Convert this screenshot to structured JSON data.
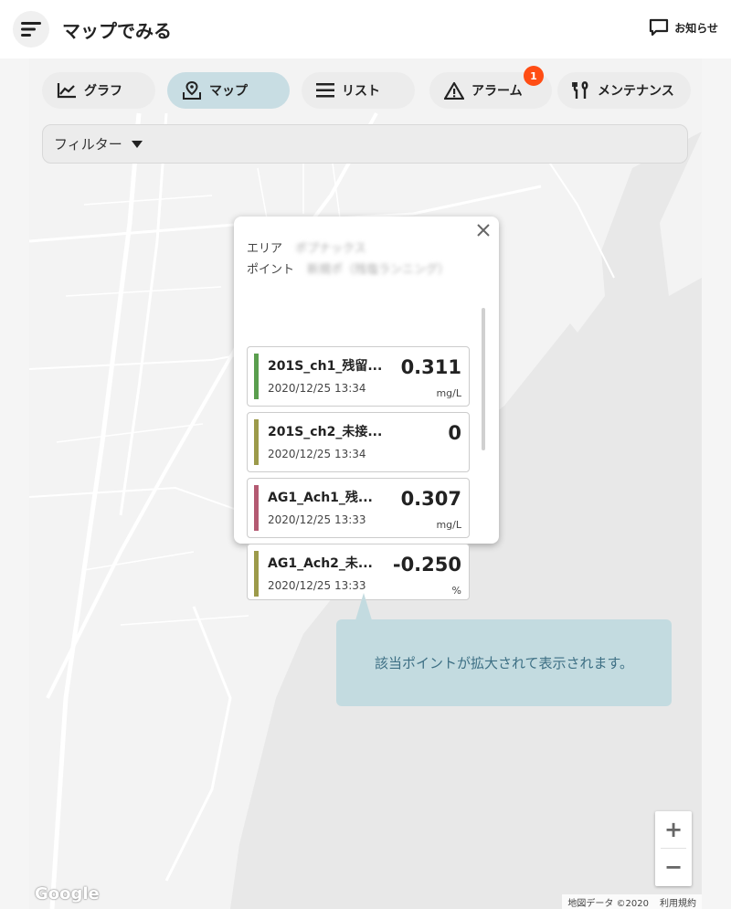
{
  "header": {
    "title": "マップでみる",
    "notice_label": "お知らせ"
  },
  "tabs": [
    {
      "label": "グラフ",
      "icon": "line-chart-icon"
    },
    {
      "label": "マップ",
      "icon": "map-pin-icon"
    },
    {
      "label": "リスト",
      "icon": "list-icon"
    },
    {
      "label": "アラーム",
      "icon": "warning-icon"
    },
    {
      "label": "メンテナンス",
      "icon": "tools-icon"
    }
  ],
  "alarm_badge": "1",
  "filter": {
    "label": "フィルター"
  },
  "popup": {
    "area_label": "エリア",
    "area_value": "ポプナックス",
    "point_label": "ポイント",
    "point_value": "新規ポ（残塩ランニング）",
    "cards": [
      {
        "name": "201S_ch1_残留...",
        "time": "2020/12/25 13:34",
        "value": "0.311",
        "unit": "mg/L",
        "color": "#5a9e4e"
      },
      {
        "name": "201S_ch2_未接...",
        "time": "2020/12/25 13:34",
        "value": "0",
        "unit": "",
        "color": "#9c9a4a"
      },
      {
        "name": "AG1_Ach1_残...",
        "time": "2020/12/25 13:33",
        "value": "0.307",
        "unit": "mg/L",
        "color": "#b45a72"
      },
      {
        "name": "AG1_Ach2_未...",
        "time": "2020/12/25 13:33",
        "value": "-0.250",
        "unit": "%",
        "color": "#9c9a4a"
      }
    ]
  },
  "tooltip": {
    "text": "該当ポイントが拡大されて表示されます。"
  },
  "zoom": {
    "in_label": "+",
    "out_label": "−"
  },
  "map": {
    "logo": "Google",
    "data_credit": "地図データ ©2020",
    "terms": "利用規約"
  },
  "colors": {
    "accent_tab": "#c8dde3",
    "badge": "#ff4d14",
    "marker_green": "#6cc08f",
    "marker_red": "#e0501e"
  }
}
